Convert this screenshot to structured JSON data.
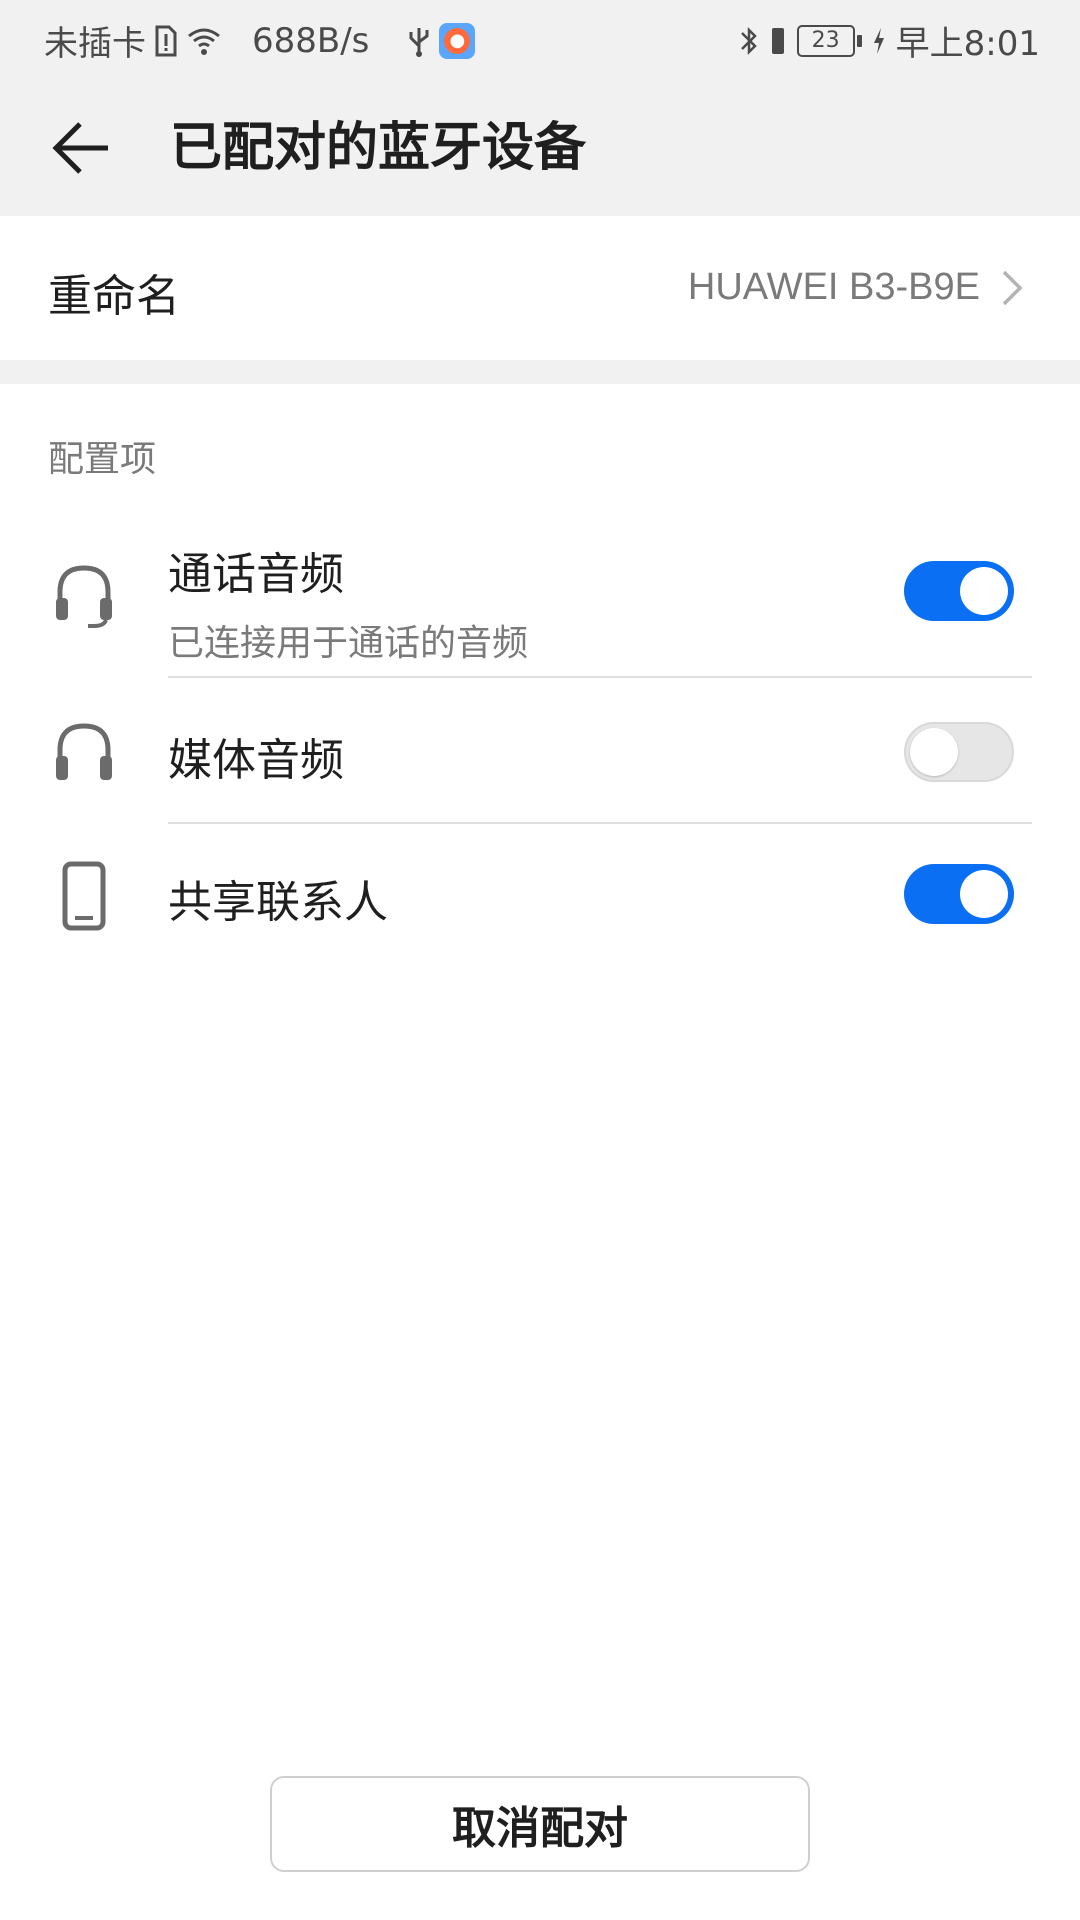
{
  "status_bar": {
    "carrier": "未插卡",
    "net_speed": "688B/s",
    "battery_level": "23",
    "time": "早上8:01"
  },
  "app_bar": {
    "title": "已配对的蓝牙设备"
  },
  "rename": {
    "label": "重命名",
    "value": "HUAWEI B3-B9E"
  },
  "config": {
    "section_title": "配置项",
    "items": [
      {
        "label": "通话音频",
        "subtitle": "已连接用于通话的音频",
        "icon": "headset-icon",
        "enabled": true
      },
      {
        "label": "媒体音频",
        "subtitle": "",
        "icon": "headphones-icon",
        "enabled": false
      },
      {
        "label": "共享联系人",
        "subtitle": "",
        "icon": "phone-icon",
        "enabled": true
      }
    ]
  },
  "actions": {
    "unpair_label": "取消配对"
  },
  "colors": {
    "accent": "#0a6ff2",
    "background": "#ffffff",
    "header_bg": "#f1f1f1",
    "secondary_text": "#7a7a7a"
  }
}
